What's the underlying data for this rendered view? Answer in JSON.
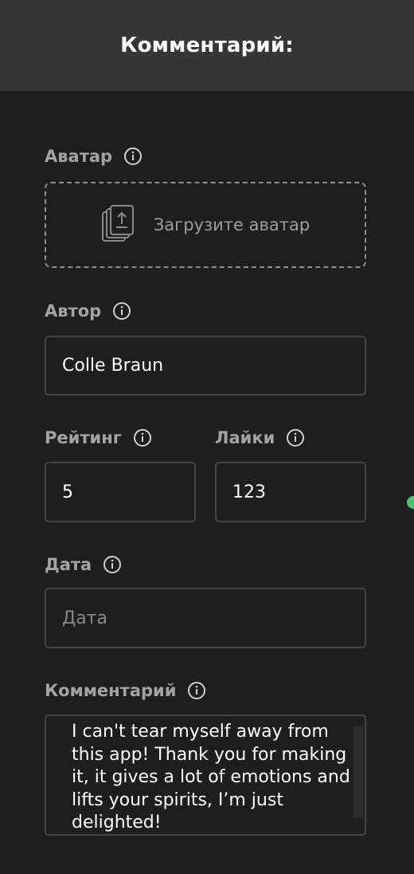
{
  "header": {
    "title": "Комментарий:"
  },
  "avatar": {
    "label": "Аватар",
    "info_icon": "info-icon",
    "upload_icon": "upload-files-icon",
    "upload_label": "Загрузите аватар"
  },
  "author": {
    "label": "Автор",
    "info_icon": "info-icon",
    "value": "Colle Braun"
  },
  "rating": {
    "label": "Рейтинг",
    "info_icon": "info-icon",
    "value": "5"
  },
  "likes": {
    "label": "Лайки",
    "info_icon": "info-icon",
    "value": "123"
  },
  "date": {
    "label": "Дата",
    "info_icon": "info-icon",
    "value": "",
    "placeholder": "Дата"
  },
  "comment": {
    "label": "Комментарий",
    "info_icon": "info-icon",
    "value": "I can't tear myself away from this app! Thank you for making it, it gives a lot of emotions and lifts your spirits, I’m just delighted!"
  },
  "colors": {
    "background": "#1e1e1e",
    "header_background": "#363636",
    "label": "#a3a3a3",
    "field_border": "#444444",
    "text": "#ffffff",
    "indicator": "#4fc36d"
  }
}
